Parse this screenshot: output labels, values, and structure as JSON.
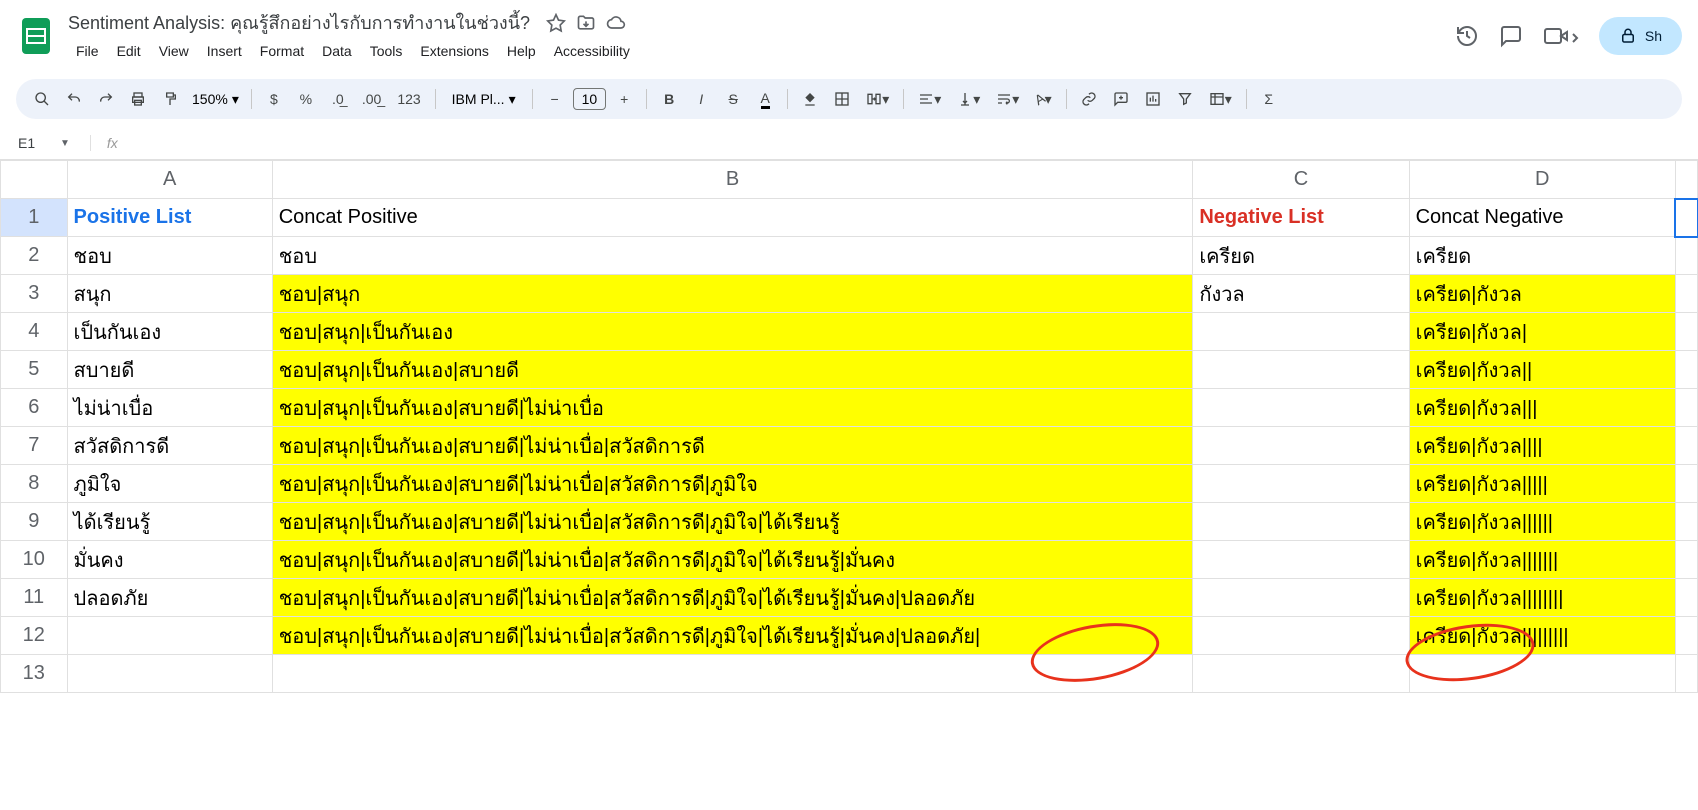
{
  "doc": {
    "title": "Sentiment Analysis: คุณรู้สึกอย่างไรกับการทำงานในช่วงนี้?"
  },
  "menu": {
    "file": "File",
    "edit": "Edit",
    "view": "View",
    "insert": "Insert",
    "format": "Format",
    "data": "Data",
    "tools": "Tools",
    "extensions": "Extensions",
    "help": "Help",
    "accessibility": "Accessibility"
  },
  "share": {
    "label": "Sh"
  },
  "toolbar": {
    "zoom": "150%",
    "currency": "$",
    "percent": "%",
    "dec_dec": ".0",
    "dec_inc": ".00",
    "num123": "123",
    "font": "IBM Pl...",
    "size": "10"
  },
  "namebox": {
    "cell": "E1"
  },
  "headers": {
    "A": "A",
    "B": "B",
    "C": "C",
    "D": "D"
  },
  "rows": {
    "r1": {
      "n": "1",
      "A": "Positive List",
      "B": "Concat Positive",
      "C": "Negative List",
      "D": "Concat Negative"
    },
    "r2": {
      "n": "2",
      "A": "ชอบ",
      "B": "ชอบ",
      "C": "เครียด",
      "D": "เครียด"
    },
    "r3": {
      "n": "3",
      "A": "สนุก",
      "B": "ชอบ|สนุก",
      "C": "กังวล",
      "D": "เครียด|กังวล"
    },
    "r4": {
      "n": "4",
      "A": "เป็นกันเอง",
      "B": "ชอบ|สนุก|เป็นกันเอง",
      "C": "",
      "D": "เครียด|กังวล|"
    },
    "r5": {
      "n": "5",
      "A": "สบายดี",
      "B": "ชอบ|สนุก|เป็นกันเอง|สบายดี",
      "C": "",
      "D": "เครียด|กังวล||"
    },
    "r6": {
      "n": "6",
      "A": "ไม่น่าเบื่อ",
      "B": "ชอบ|สนุก|เป็นกันเอง|สบายดี|ไม่น่าเบื่อ",
      "C": "",
      "D": "เครียด|กังวล|||"
    },
    "r7": {
      "n": "7",
      "A": "สวัสดิการดี",
      "B": "ชอบ|สนุก|เป็นกันเอง|สบายดี|ไม่น่าเบื่อ|สวัสดิการดี",
      "C": "",
      "D": "เครียด|กังวล||||"
    },
    "r8": {
      "n": "8",
      "A": "ภูมิใจ",
      "B": "ชอบ|สนุก|เป็นกันเอง|สบายดี|ไม่น่าเบื่อ|สวัสดิการดี|ภูมิใจ",
      "C": "",
      "D": "เครียด|กังวล|||||"
    },
    "r9": {
      "n": "9",
      "A": "ได้เรียนรู้",
      "B": "ชอบ|สนุก|เป็นกันเอง|สบายดี|ไม่น่าเบื่อ|สวัสดิการดี|ภูมิใจ|ได้เรียนรู้",
      "C": "",
      "D": "เครียด|กังวล||||||"
    },
    "r10": {
      "n": "10",
      "A": "มั่นคง",
      "B": "ชอบ|สนุก|เป็นกันเอง|สบายดี|ไม่น่าเบื่อ|สวัสดิการดี|ภูมิใจ|ได้เรียนรู้|มั่นคง",
      "C": "",
      "D": "เครียด|กังวล|||||||"
    },
    "r11": {
      "n": "11",
      "A": "ปลอดภัย",
      "B": "ชอบ|สนุก|เป็นกันเอง|สบายดี|ไม่น่าเบื่อ|สวัสดิการดี|ภูมิใจ|ได้เรียนรู้|มั่นคง|ปลอดภัย",
      "C": "",
      "D": "เครียด|กังวล||||||||"
    },
    "r12": {
      "n": "12",
      "A": "",
      "B": "ชอบ|สนุก|เป็นกันเอง|สบายดี|ไม่น่าเบื่อ|สวัสดิการดี|ภูมิใจ|ได้เรียนรู้|มั่นคง|ปลอดภัย|",
      "C": "",
      "D": "เครียด|กังวล|||||||||"
    },
    "r13": {
      "n": "13",
      "A": "",
      "B": "",
      "C": "",
      "D": ""
    }
  }
}
